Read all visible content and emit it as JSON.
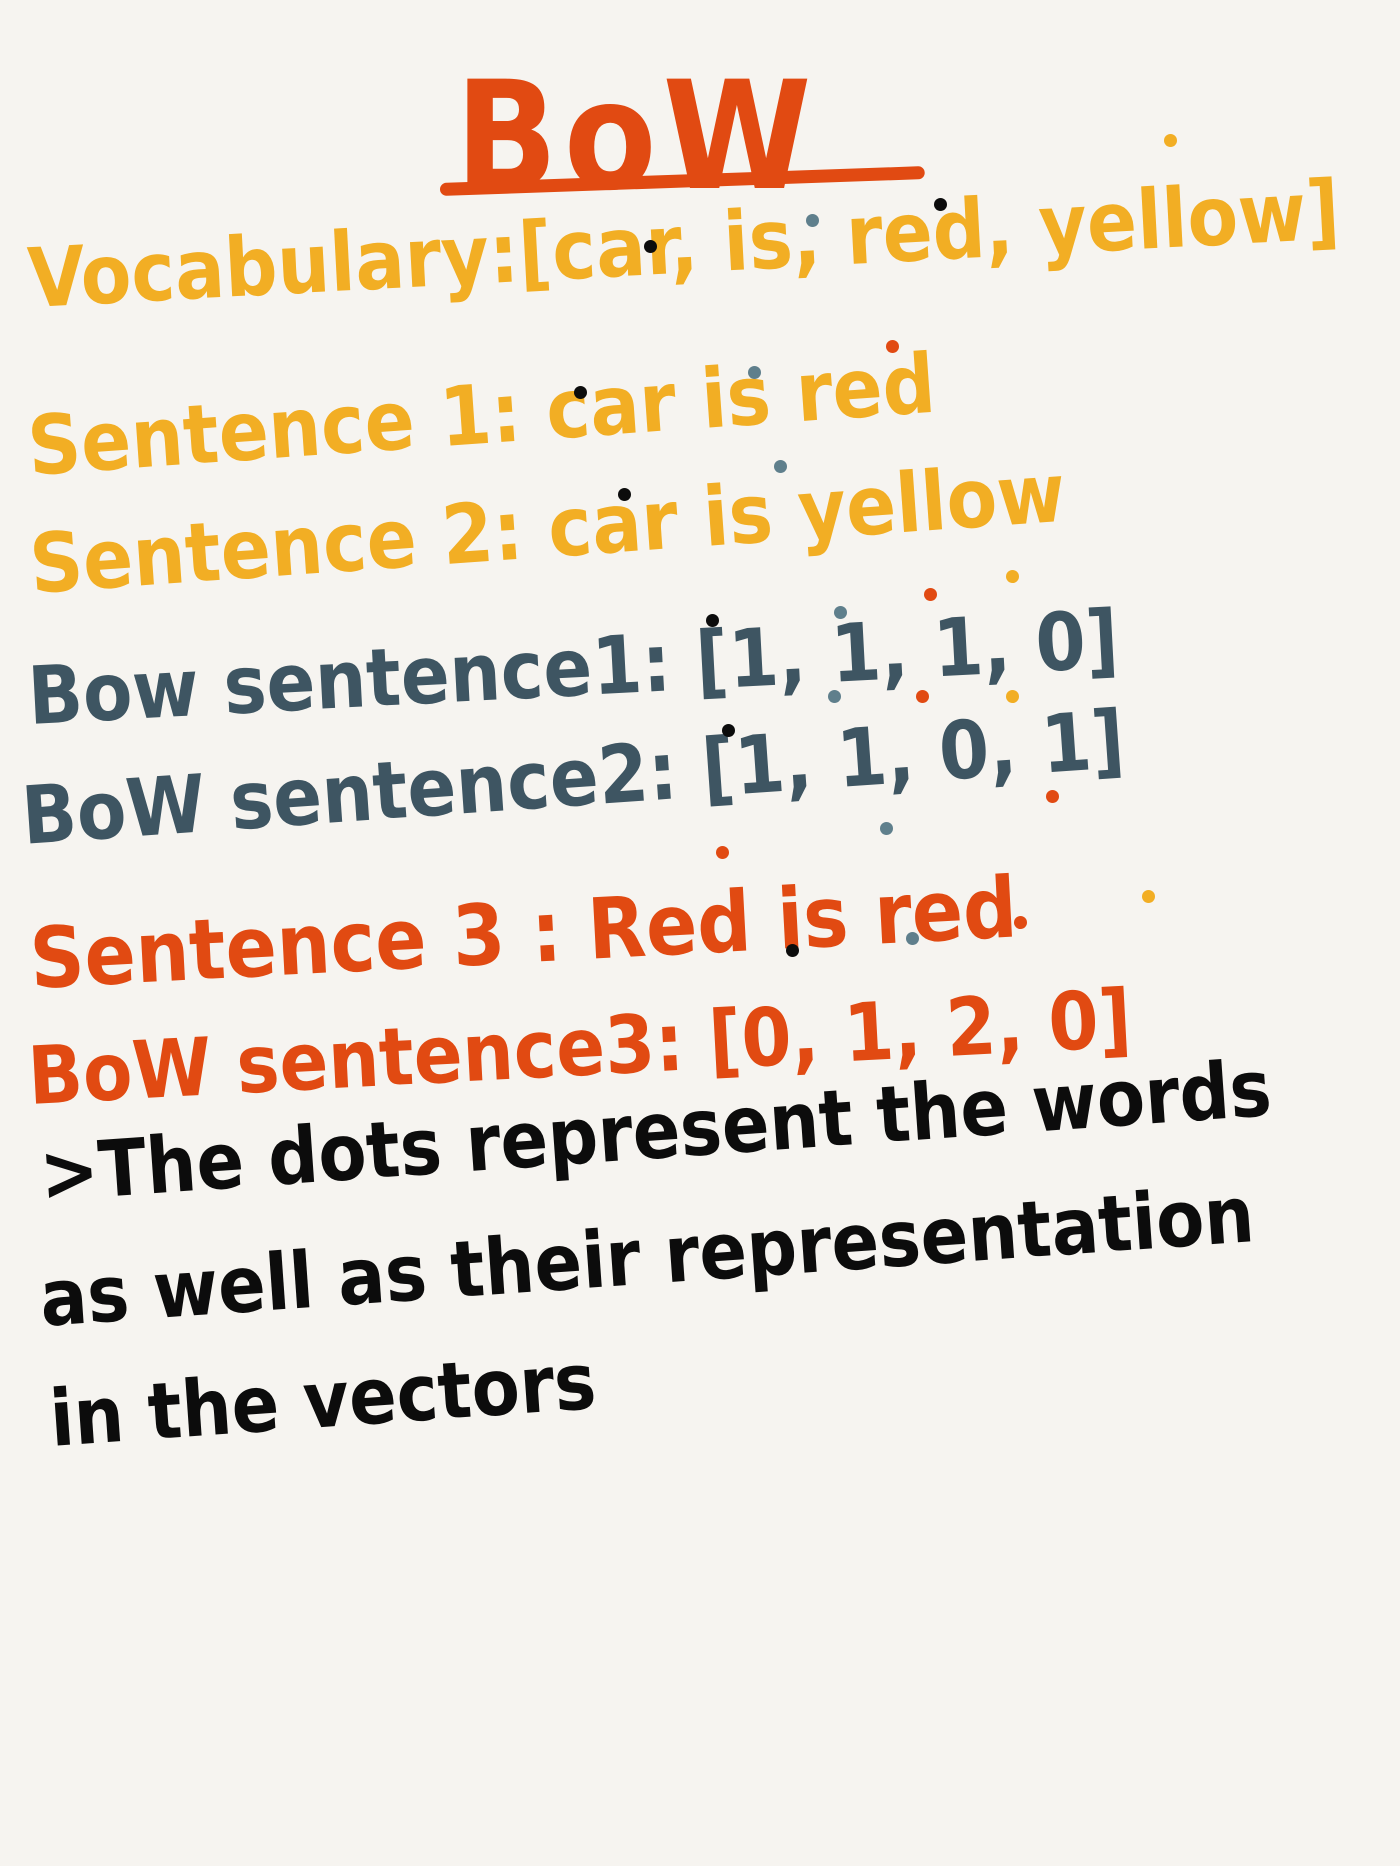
{
  "colors": {
    "background": "#f6f4f0",
    "orange": "#e14a12",
    "yellow": "#f2ae24",
    "slate": "#3e5562",
    "black": "#0c0c0c"
  },
  "title": "BoW",
  "lines": {
    "vocabulary": "Vocabulary:[car, is, red, yellow]",
    "sentence1": "Sentence 1: car is red",
    "sentence2": "Sentence 2: car is yellow",
    "bow_sentence1": "Bow sentence1: [1, 1, 1, 0]",
    "bow_sentence2": "BoW sentence2: [1, 1, 0, 1]",
    "sentence3": "Sentence 3 : Red is red",
    "bow_sentence3": "BoW sentence3: [0, 1, 2, 0]",
    "note_line1": ">The dots represent the words",
    "note_line2": "as well as their representation",
    "note_line3": "in the vectors"
  },
  "word_marker_colors": {
    "car": "black",
    "is": "slate",
    "red": "orange",
    "yellow": "yellow"
  }
}
